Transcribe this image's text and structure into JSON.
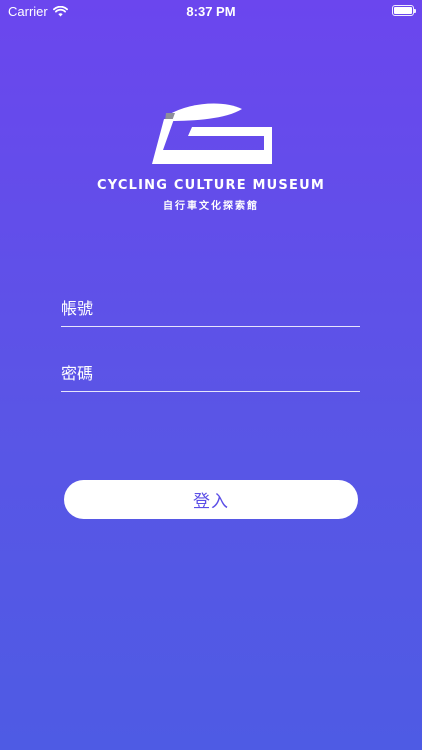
{
  "status_bar": {
    "carrier": "Carrier",
    "time": "8:37 PM"
  },
  "branding": {
    "name_en": "CYCLING CULTURE MUSEUM",
    "name_zh": "自行車文化探索館",
    "logo": "bicycle-saddle-logo"
  },
  "form": {
    "account_placeholder": "帳號",
    "account_value": "",
    "password_placeholder": "密碼",
    "password_value": "",
    "login_label": "登入"
  },
  "colors": {
    "background_top": "#6B46EE",
    "background_bottom": "#4E5BE4",
    "button_bg": "#FFFFFF",
    "button_text": "#5B4EE6",
    "logo_accent": "#8E8E9A"
  }
}
